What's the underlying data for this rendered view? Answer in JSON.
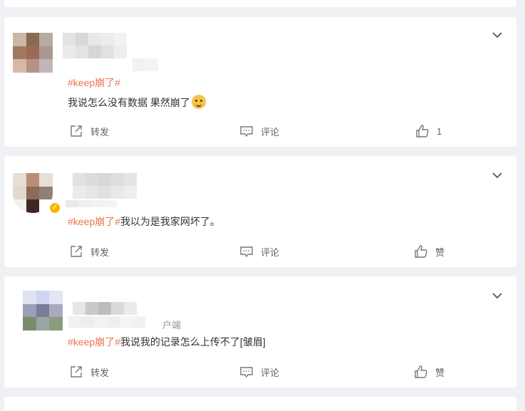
{
  "colors": {
    "page_bg": "#f0f1f4",
    "card_bg": "#ffffff",
    "hashtag": "#eb7350",
    "action_text": "#636363",
    "verified_badge": "#ffb400"
  },
  "icons": {
    "expand": "chevron-down-icon",
    "repost": "share-arrow-icon",
    "comment": "comment-bubble-icon",
    "like": "thumbs-up-icon",
    "verified": "verified-badge-icon",
    "emoji": "doge-emoji-icon"
  },
  "posts": [
    {
      "hashtag": "#keep崩了#",
      "text": "我说怎么没有数据 果然崩了",
      "source": "",
      "actions": {
        "repost_label": "转发",
        "comment_label": "评论",
        "like_label": "1"
      }
    },
    {
      "hashtag": "#keep崩了#",
      "text": "我以为是我家网坏了。",
      "source": "",
      "actions": {
        "repost_label": "转发",
        "comment_label": "评论",
        "like_label": "赞"
      }
    },
    {
      "hashtag": "#keep崩了#",
      "text": "我说我的记录怎么上传不了[皱眉]",
      "source": "户端",
      "actions": {
        "repost_label": "转发",
        "comment_label": "评论",
        "like_label": "赞"
      }
    }
  ]
}
